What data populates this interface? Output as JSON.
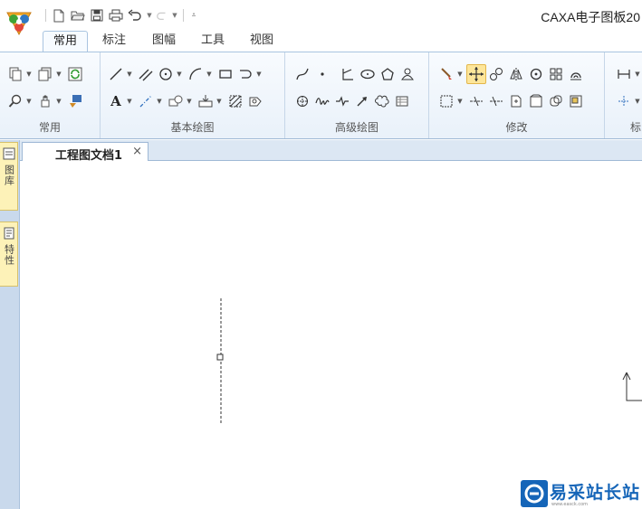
{
  "window": {
    "title": "CAXA电子图板20"
  },
  "tabs": [
    {
      "label": "常用",
      "active": true
    },
    {
      "label": "标注"
    },
    {
      "label": "图幅"
    },
    {
      "label": "工具"
    },
    {
      "label": "视图"
    }
  ],
  "ribbon": {
    "groups": [
      {
        "label": "常用"
      },
      {
        "label": "基本绘图"
      },
      {
        "label": "高级绘图"
      },
      {
        "label": "修改"
      },
      {
        "label": "标"
      }
    ]
  },
  "left_dock": [
    {
      "label": "图库"
    },
    {
      "label": "特性"
    }
  ],
  "document": {
    "tab_title": "工程图文档1",
    "close_glyph": "×"
  },
  "watermark": {
    "text": "易采站长站",
    "url": "www.easck.com"
  },
  "colors": {
    "accent": "#1565b8",
    "ribbon_bg": "#eaf2fb",
    "highlight": "#fde69a"
  },
  "icons": {
    "qat": [
      "new-file-icon",
      "open-folder-icon",
      "save-icon",
      "print-icon",
      "undo-icon",
      "redo-icon",
      "customize-icon"
    ],
    "common": [
      "copy-icon",
      "layer-icon",
      "refresh-icon",
      "zoom-icon",
      "pan-icon",
      "format-painter-icon"
    ],
    "basic": [
      "line-icon",
      "parallel-icon",
      "circle-icon",
      "arc-icon",
      "rectangle-icon",
      "polyline-icon",
      "text-icon",
      "centerline-icon",
      "block-icon",
      "insert-icon",
      "hatch-icon",
      "region-icon"
    ],
    "advanced": [
      "spline-icon",
      "point-icon",
      "angle-icon",
      "ellipse-icon",
      "polygon-icon",
      "figure-icon",
      "rotate-icon",
      "wave-icon",
      "break-line-icon",
      "arrow-icon",
      "cloud-icon",
      "table-icon"
    ],
    "modify": [
      "erase-icon",
      "move-icon",
      "copy-move-icon",
      "mirror-icon",
      "rotate2-icon",
      "array-icon",
      "offset-icon",
      "select-box-icon",
      "trim-icon",
      "extend-icon",
      "scale-icon",
      "stretch-icon",
      "fillet-icon",
      "explode-icon"
    ]
  }
}
